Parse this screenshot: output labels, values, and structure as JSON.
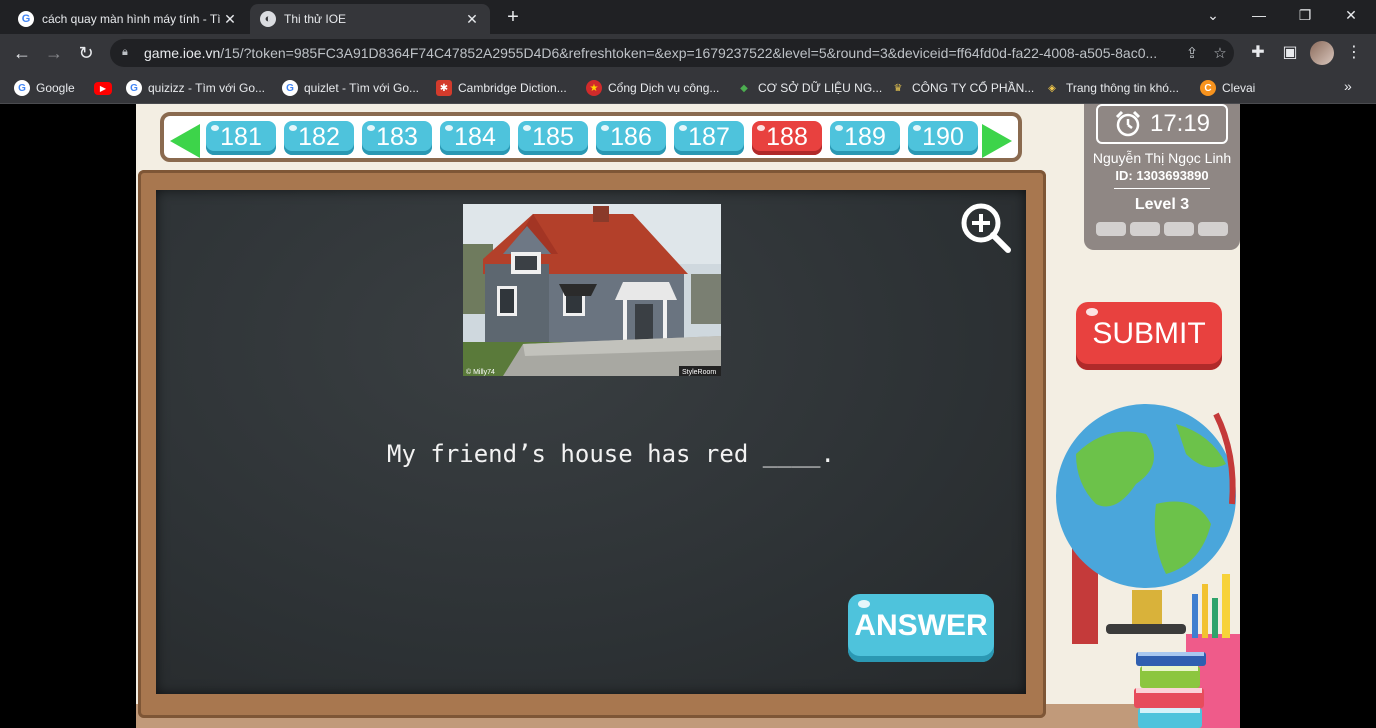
{
  "browser": {
    "tabs": [
      {
        "title": "cách quay màn hình máy tính - Tì",
        "active": false
      },
      {
        "title": "Thi thử IOE",
        "active": true
      }
    ],
    "url_host": "game.ioe.vn",
    "url_path": "/15/?token=985FC3A91D8364F74C47852A2955D4D6&refreshtoken=&exp=1679237522&level=5&round=3&deviceid=ff64fd0d-fa22-4008-a505-8ac0...",
    "bookmarks": [
      {
        "label": "Google"
      },
      {
        "label": ""
      },
      {
        "label": "quizizz - Tìm với Go..."
      },
      {
        "label": "quizlet - Tìm với Go..."
      },
      {
        "label": "Cambridge Diction..."
      },
      {
        "label": "Cổng Dịch vụ công..."
      },
      {
        "label": "CƠ SỞ DỮ LIỆU NG..."
      },
      {
        "label": "CÔNG TY CỔ PHẦN..."
      },
      {
        "label": "Trang thông tin khó..."
      },
      {
        "label": "Clevai"
      }
    ],
    "bookmarks_more": "»"
  },
  "game": {
    "question_numbers": [
      "181",
      "182",
      "183",
      "184",
      "185",
      "186",
      "187",
      "188",
      "189",
      "190"
    ],
    "current_question": "188",
    "question_text": "My friend’s house has red ____.",
    "photo_credit_left": "© Milly74",
    "photo_credit_right": "StyleRoom",
    "answer_label": "ANSWER",
    "submit_label": "SUBMIT",
    "timer": "17:19",
    "user_name": "Nguyễn Thị Ngọc  Linh",
    "user_id": "ID: 1303693890",
    "level": "Level 3",
    "level_progress_filled": 0,
    "level_progress_total": 4
  },
  "colors": {
    "question_button": "#4ec3dc",
    "active_question_button": "#e8413f",
    "nav_arrow": "#3dd44a",
    "chalkboard": "#2f3437"
  }
}
